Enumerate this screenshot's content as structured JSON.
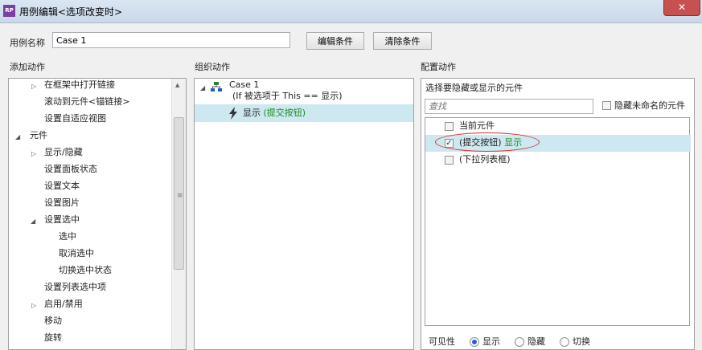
{
  "window": {
    "title": "用例编辑<选项改变时>",
    "app_icon_text": "RP",
    "close_glyph": "✕"
  },
  "case": {
    "label": "用例名称",
    "value": "Case 1",
    "edit_button": "编辑条件",
    "clear_button": "清除条件"
  },
  "add_actions": {
    "header": "添加动作",
    "items": [
      {
        "label": "在框架中打开链接"
      },
      {
        "label": "滚动到元件<锚链接>"
      },
      {
        "label": "设置自适应视图"
      },
      {
        "label": "元件"
      },
      {
        "label": "显示/隐藏"
      },
      {
        "label": "设置面板状态"
      },
      {
        "label": "设置文本"
      },
      {
        "label": "设置图片"
      },
      {
        "label": "设置选中"
      },
      {
        "label": "选中"
      },
      {
        "label": "取消选中"
      },
      {
        "label": "切换选中状态"
      },
      {
        "label": "设置列表选中项"
      },
      {
        "label": "启用/禁用"
      },
      {
        "label": "移动"
      },
      {
        "label": "旋转"
      }
    ]
  },
  "organize": {
    "header": "组织动作",
    "case_name": "Case 1",
    "condition": "(If 被选项于 This == 显示)",
    "action_verb": "显示",
    "action_target": "(提交按钮)"
  },
  "configure": {
    "header": "配置动作",
    "section_label": "选择要隐藏或显示的元件",
    "search_placeholder": "查找",
    "hide_unnamed_label": "隐藏未命名的元件",
    "widgets": [
      {
        "label": "当前元件",
        "checked": false,
        "status": ""
      },
      {
        "label": "(提交按钮)",
        "checked": true,
        "status": "显示"
      },
      {
        "label": "(下拉列表框)",
        "checked": false,
        "status": ""
      }
    ],
    "visibility": {
      "label": "可见性",
      "options": [
        "显示",
        "隐藏",
        "切换"
      ],
      "selected": "显示"
    }
  },
  "colors": {
    "selection": "#cde8f0",
    "status_green": "#1a8a1a",
    "highlight_red": "#d63030"
  }
}
